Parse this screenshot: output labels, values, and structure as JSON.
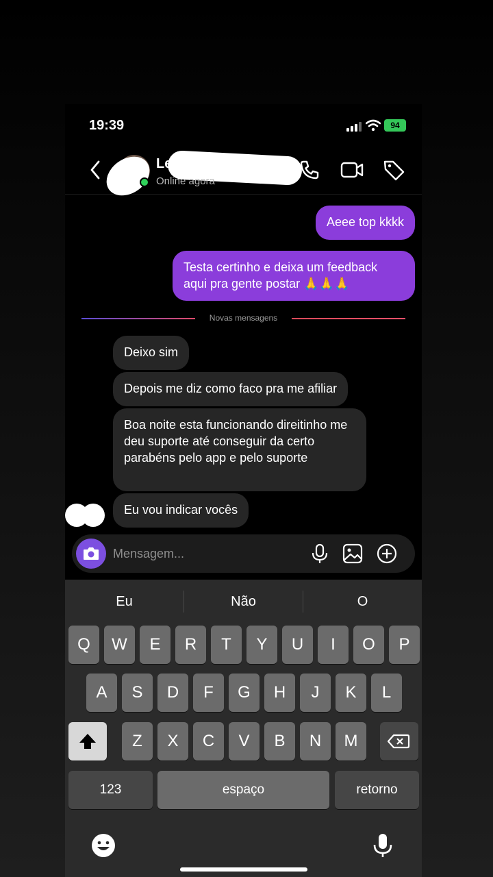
{
  "status_bar": {
    "time": "19:39",
    "battery": "94"
  },
  "header": {
    "name": "Le",
    "status": "Online agora",
    "back_icon": "chevron-left-icon",
    "call_icon": "phone-icon",
    "video_icon": "video-camera-icon",
    "tag_icon": "tag-icon"
  },
  "messages": {
    "out": [
      "Aeee top kkkk",
      "Testa certinho e deixa um feedback aqui pra gente postar 🙏🙏🙏"
    ],
    "divider": "Novas mensagens",
    "in": [
      "Deixo sim",
      "Depois me diz como faco pra me afiliar",
      "Boa noite esta funcionando direitinho me deu  suporte até  conseguir da certo parabéns pelo app e pelo suporte",
      "Eu vou indicar vocês"
    ]
  },
  "composer": {
    "placeholder": "Mensagem..."
  },
  "keyboard": {
    "suggestions": [
      "Eu",
      "Não",
      "O"
    ],
    "row1": [
      "Q",
      "W",
      "E",
      "R",
      "T",
      "Y",
      "U",
      "I",
      "O",
      "P"
    ],
    "row2": [
      "A",
      "S",
      "D",
      "F",
      "G",
      "H",
      "J",
      "K",
      "L"
    ],
    "row3": [
      "Z",
      "X",
      "C",
      "V",
      "B",
      "N",
      "M"
    ],
    "numbers": "123",
    "space": "espaço",
    "return": "retorno"
  },
  "colors": {
    "accent": "#8b3ddb",
    "incoming": "#262626",
    "online": "#2fd15a",
    "battery": "#34c759"
  }
}
